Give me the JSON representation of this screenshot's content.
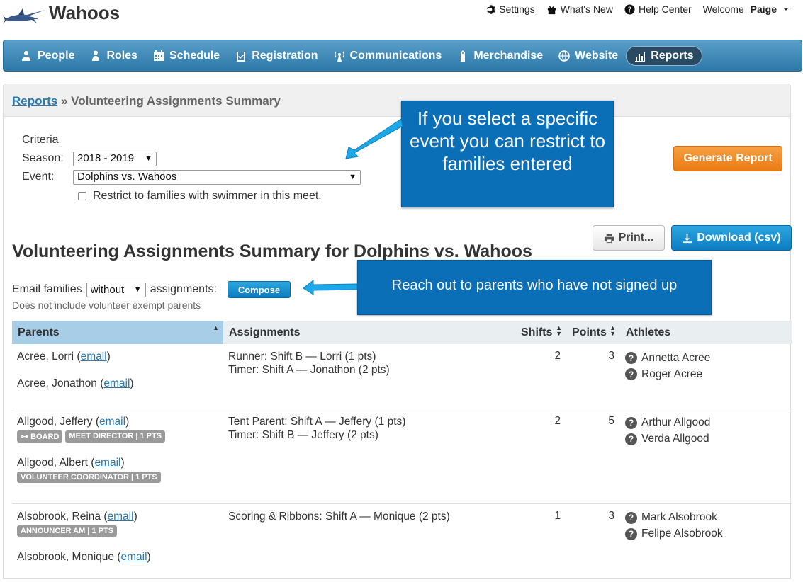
{
  "app": {
    "brand": "Wahoos"
  },
  "topnav": {
    "settings": "Settings",
    "whats_new": "What's New",
    "help_center": "Help Center",
    "welcome_prefix": "Welcome ",
    "user_name": "Paige"
  },
  "mainnav": {
    "items": [
      {
        "label": "People",
        "icon": "people-icon"
      },
      {
        "label": "Roles",
        "icon": "roles-icon"
      },
      {
        "label": "Schedule",
        "icon": "calendar-icon"
      },
      {
        "label": "Registration",
        "icon": "clipboard-check-icon"
      },
      {
        "label": "Communications",
        "icon": "broadcast-icon"
      },
      {
        "label": "Merchandise",
        "icon": "price-tag-icon"
      },
      {
        "label": "Website",
        "icon": "globe-icon"
      },
      {
        "label": "Reports",
        "icon": "bar-chart-icon",
        "active": true
      }
    ]
  },
  "breadcrumb": {
    "root": "Reports",
    "separator": " » ",
    "current": "Volunteering Assignments Summary"
  },
  "criteria": {
    "heading": "Criteria",
    "season_label": "Season:",
    "season_value": "2018 - 2019",
    "event_label": "Event:",
    "event_value": "Dolphins vs. Wahoos",
    "restrict_label": "Restrict to families with swimmer in this meet.",
    "restrict_checked": false
  },
  "buttons": {
    "generate": "Generate Report",
    "print": "Print...",
    "download": "Download (csv)",
    "compose": "Compose"
  },
  "report": {
    "title": "Volunteering Assignments Summary for Dolphins vs. Wahoos",
    "email_prefix": "Email families",
    "email_filter": "without",
    "email_suffix": "assignments:",
    "note": "Does not include volunteer exempt parents"
  },
  "callouts": {
    "event_tip": "If you select a specific event you can restrict to families entered",
    "compose_tip": "Reach out to parents who have not signed up"
  },
  "table": {
    "headers": [
      "Parents",
      "Assignments",
      "Shifts",
      "Points",
      "Athletes"
    ],
    "email_link": "email",
    "rows": [
      {
        "parents": [
          {
            "name": "Acree, Lorri",
            "badges": []
          },
          {
            "name": "Acree, Jonathon",
            "badges": []
          }
        ],
        "assignments": [
          "Runner: Shift B — Lorri (1 pts)",
          "Timer: Shift A — Jonathon (2 pts)"
        ],
        "shifts": "2",
        "points": "3",
        "athletes": [
          "Annetta Acree",
          "Roger Acree"
        ]
      },
      {
        "parents": [
          {
            "name": "Allgood, Jeffery",
            "badges": [
              "BOARD",
              "MEET DIRECTOR | 1 PTS"
            ]
          },
          {
            "name": "Allgood, Albert",
            "badges": [
              "VOLUNTEER COORDINATOR | 1 PTS"
            ]
          }
        ],
        "assignments": [
          "Tent Parent: Shift A — Jeffery (1 pts)",
          "Timer: Shift B — Jeffery (2 pts)"
        ],
        "shifts": "2",
        "points": "5",
        "athletes": [
          "Arthur Allgood",
          "Verda Allgood"
        ]
      },
      {
        "parents": [
          {
            "name": "Alsobrook, Reina",
            "badges": [
              "ANNOUNCER AM | 1 PTS"
            ]
          },
          {
            "name": "Alsobrook, Monique",
            "badges": []
          }
        ],
        "assignments": [
          "Scoring & Ribbons: Shift A — Monique (2 pts)"
        ],
        "shifts": "1",
        "points": "3",
        "athletes": [
          "Mark Alsobrook",
          "Felipe Alsobrook"
        ]
      }
    ]
  }
}
